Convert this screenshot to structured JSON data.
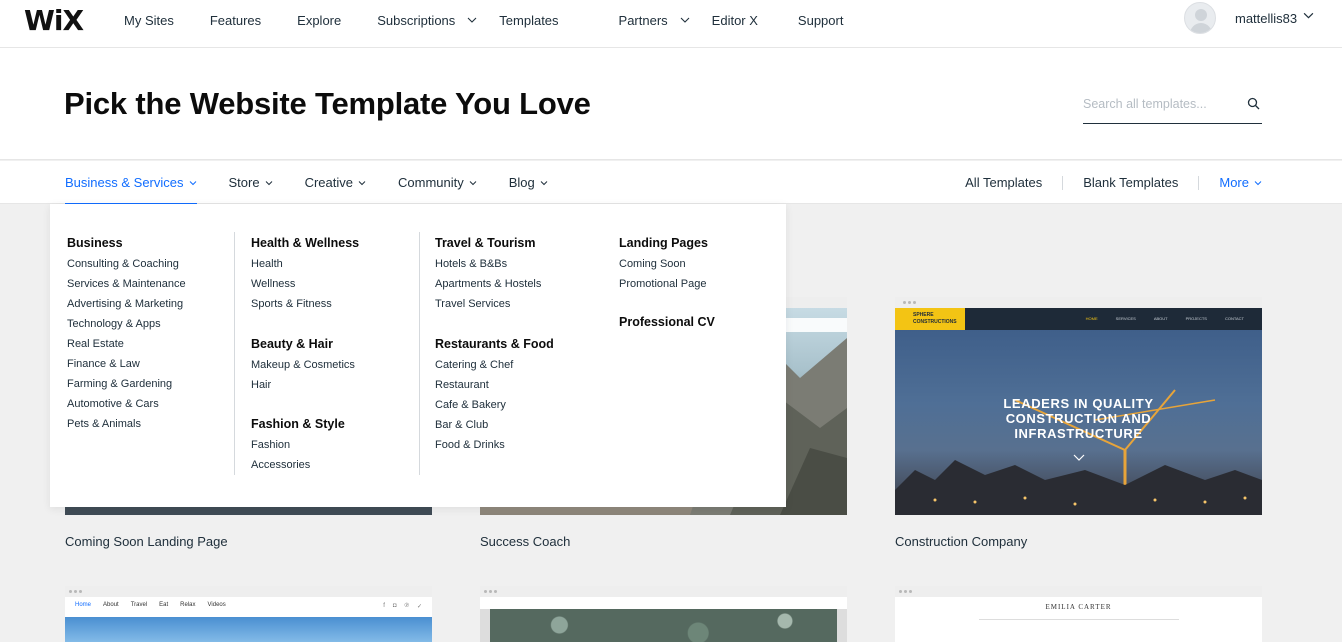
{
  "brand": {
    "logo": "WiX"
  },
  "topnav": {
    "items": [
      "My Sites",
      "Features",
      "Explore",
      "Subscriptions",
      "Templates",
      "Partners",
      "Editor X",
      "Support"
    ],
    "user": "mattellis83"
  },
  "hero": {
    "title": "Pick the Website Template You Love",
    "search_placeholder": "Search all templates..."
  },
  "categories": {
    "left": [
      "Business & Services",
      "Store",
      "Creative",
      "Community",
      "Blog"
    ],
    "right": [
      "All Templates",
      "Blank Templates",
      "More"
    ]
  },
  "mega_menu": {
    "columns": [
      [
        {
          "title": "Business",
          "items": [
            "Consulting & Coaching",
            "Services & Maintenance",
            "Advertising & Marketing",
            "Technology & Apps",
            "Real Estate",
            "Finance & Law",
            "Farming & Gardening",
            "Automotive & Cars",
            "Pets & Animals"
          ]
        }
      ],
      [
        {
          "title": "Health & Wellness",
          "items": [
            "Health",
            "Wellness",
            "Sports & Fitness"
          ]
        },
        {
          "title": "Beauty & Hair",
          "items": [
            "Makeup & Cosmetics",
            "Hair"
          ]
        },
        {
          "title": "Fashion & Style",
          "items": [
            "Fashion",
            "Accessories"
          ]
        }
      ],
      [
        {
          "title": "Travel & Tourism",
          "items": [
            "Hotels & B&Bs",
            "Apartments & Hostels",
            "Travel Services"
          ]
        },
        {
          "title": "Restaurants & Food",
          "items": [
            "Catering & Chef",
            "Restaurant",
            "Cafe & Bakery",
            "Bar & Club",
            "Food & Drinks"
          ]
        }
      ],
      [
        {
          "title": "Landing Pages",
          "items": [
            "Coming Soon",
            "Promotional Page"
          ]
        },
        {
          "title": "Professional CV",
          "items": []
        }
      ]
    ]
  },
  "templates": {
    "row1": [
      "Coming Soon Landing Page",
      "Success Coach",
      "Construction Company"
    ],
    "construction_preview": {
      "brand": "SPHERE CONSTRUCTIONS",
      "nav": [
        "HOME",
        "SERVICES",
        "ABOUT",
        "PROJECTS",
        "CONTACT"
      ],
      "headline": [
        "LEADERS IN QUALITY",
        "CONSTRUCTION AND",
        "INFRASTRUCTURE"
      ]
    },
    "travel_preview": {
      "nav": [
        "Home",
        "About",
        "Travel",
        "Eat",
        "Relax",
        "Videos"
      ]
    },
    "emilia_preview": {
      "name": "EMILIA CARTER"
    }
  },
  "colors": {
    "accent": "#116dff",
    "text": "#20303c",
    "background": "#f0f0f0"
  }
}
